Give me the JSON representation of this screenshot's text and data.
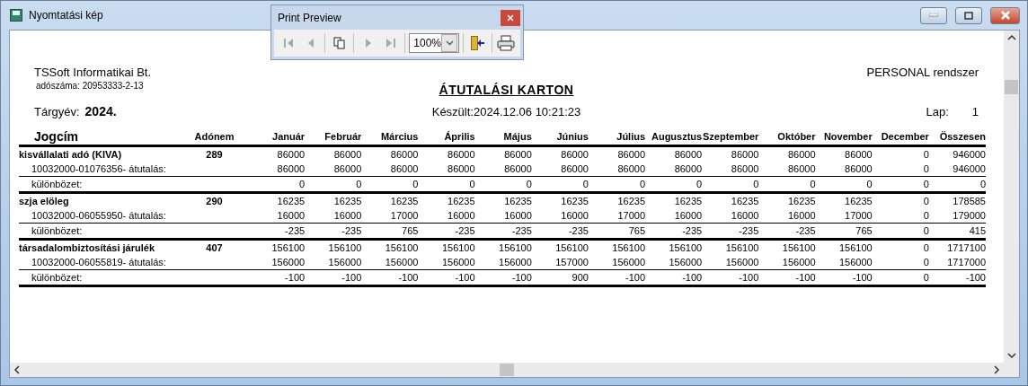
{
  "window": {
    "title": "Nyomtatási kép"
  },
  "preview_toolbar": {
    "title": "Print Preview",
    "buttons": [
      {
        "kind": "first",
        "disabled": true
      },
      {
        "kind": "prev",
        "disabled": true
      },
      {
        "kind": "pages",
        "disabled": false
      },
      {
        "kind": "next",
        "disabled": true
      },
      {
        "kind": "last",
        "disabled": true
      }
    ],
    "zoom": "100%",
    "actions": [
      {
        "kind": "exit"
      },
      {
        "kind": "print"
      }
    ]
  },
  "report": {
    "company": "TSSoft Informatikai Bt.",
    "tax_id_label": "adószáma:",
    "tax_id": "20953333-2-13",
    "system": "PERSONAL rendszer",
    "title": "ÁTUTALÁSI KARTON",
    "year_label": "Tárgyév:",
    "year": "2024.",
    "created": "Készült:2024.12.06 10:21:23",
    "page_label": "Lap:",
    "page": "1"
  },
  "table": {
    "columns": [
      "Jogcím",
      "Adónem",
      "Január",
      "Február",
      "Március",
      "Április",
      "Május",
      "Június",
      "Július",
      "Augusztus",
      "Szeptember",
      "Október",
      "November",
      "December",
      "Összesen"
    ],
    "groups": [
      {
        "name": "kisvállalati adó (KIVA)",
        "code": "289",
        "values": [
          "86000",
          "86000",
          "86000",
          "86000",
          "86000",
          "86000",
          "86000",
          "86000",
          "86000",
          "86000",
          "86000",
          "0",
          "946000"
        ],
        "transfer": {
          "label": "10032000-01076356- átutalás:",
          "values": [
            "86000",
            "86000",
            "86000",
            "86000",
            "86000",
            "86000",
            "86000",
            "86000",
            "86000",
            "86000",
            "86000",
            "0",
            "946000"
          ]
        },
        "difference": {
          "label": "különbözet:",
          "values": [
            "0",
            "0",
            "0",
            "0",
            "0",
            "0",
            "0",
            "0",
            "0",
            "0",
            "0",
            "0",
            "0"
          ]
        }
      },
      {
        "name": "szja elöleg",
        "code": "290",
        "values": [
          "16235",
          "16235",
          "16235",
          "16235",
          "16235",
          "16235",
          "16235",
          "16235",
          "16235",
          "16235",
          "16235",
          "0",
          "178585"
        ],
        "transfer": {
          "label": "10032000-06055950- átutalás:",
          "values": [
            "16000",
            "16000",
            "17000",
            "16000",
            "16000",
            "16000",
            "17000",
            "16000",
            "16000",
            "16000",
            "17000",
            "0",
            "179000"
          ]
        },
        "difference": {
          "label": "különbözet:",
          "values": [
            "-235",
            "-235",
            "765",
            "-235",
            "-235",
            "-235",
            "765",
            "-235",
            "-235",
            "-235",
            "765",
            "0",
            "415"
          ]
        }
      },
      {
        "name": "társadalombiztosítási járulék",
        "code": "407",
        "values": [
          "156100",
          "156100",
          "156100",
          "156100",
          "156100",
          "156100",
          "156100",
          "156100",
          "156100",
          "156100",
          "156100",
          "0",
          "1717100"
        ],
        "transfer": {
          "label": "10032000-06055819- átutalás:",
          "values": [
            "156000",
            "156000",
            "156000",
            "156000",
            "156000",
            "157000",
            "156000",
            "156000",
            "156000",
            "156000",
            "156000",
            "0",
            "1717000"
          ]
        },
        "difference": {
          "label": "különbözet:",
          "values": [
            "-100",
            "-100",
            "-100",
            "-100",
            "-100",
            "900",
            "-100",
            "-100",
            "-100",
            "-100",
            "-100",
            "0",
            "-100"
          ]
        }
      }
    ]
  }
}
